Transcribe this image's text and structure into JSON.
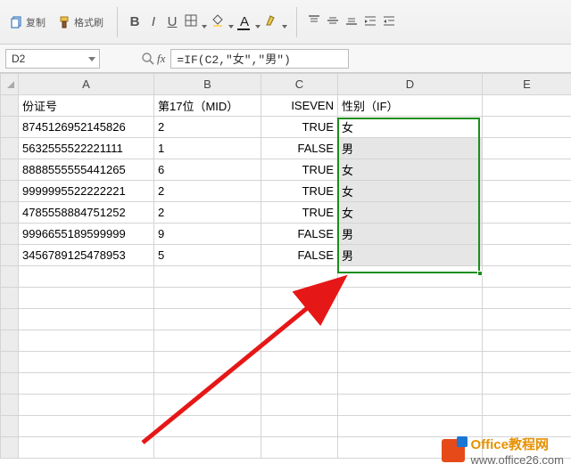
{
  "ribbon": {
    "copy": "复制",
    "format_painter": "格式刷",
    "bold": "B",
    "italic": "I",
    "underline": "U",
    "font_color": "A"
  },
  "name_box": "D2",
  "fx_label": "fx",
  "formula": "=IF(C2,\"女\",\"男\")",
  "columns": [
    "A",
    "B",
    "C",
    "D",
    "E"
  ],
  "headers": {
    "A": "份证号",
    "B": "第17位（MID）",
    "C": "ISEVEN",
    "D": "性别（IF）",
    "E": ""
  },
  "rows": [
    {
      "A": "8745126952145826",
      "B": "2",
      "C": "TRUE",
      "D": "女"
    },
    {
      "A": "5632555522221111",
      "B": "1",
      "C": "FALSE",
      "D": "男"
    },
    {
      "A": "8888555555441265",
      "B": "6",
      "C": "TRUE",
      "D": "女"
    },
    {
      "A": "9999995522222221",
      "B": "2",
      "C": "TRUE",
      "D": "女"
    },
    {
      "A": "4785558884751252",
      "B": "2",
      "C": "TRUE",
      "D": "女"
    },
    {
      "A": "9996655189599999",
      "B": "9",
      "C": "FALSE",
      "D": "男"
    },
    {
      "A": "3456789125478953",
      "B": "5",
      "C": "FALSE",
      "D": "男"
    }
  ],
  "watermark": {
    "title": "Office教程网",
    "url": "www.office26.com"
  }
}
